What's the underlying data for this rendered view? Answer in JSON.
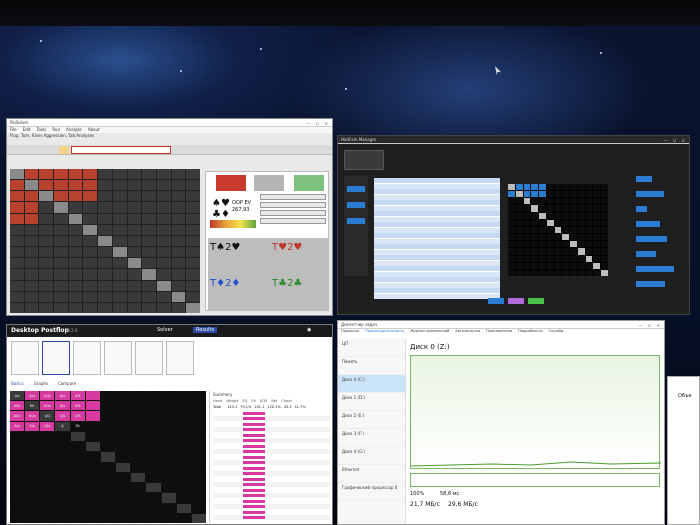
{
  "solver_window": {
    "title": "PioSolver",
    "menu": [
      "File",
      "Edit",
      "Tools",
      "Run",
      "Analyze",
      "About"
    ],
    "toolbar_line": "Flop, Turn, River Aggression, Tab Analyses",
    "ev_label": "OOP EV",
    "ev_value": "267.93",
    "card_boxes": [
      "T♠2♥",
      "T♥2♥",
      "T♦2♦",
      "T♣2♣"
    ],
    "legend_colors": [
      "#c83a2c",
      "#6a6a6a",
      "#3a8a3a"
    ]
  },
  "hud_window": {
    "title": "Hold'em Manager",
    "menu": [
      "Settings",
      "Help"
    ],
    "stat_labels": [
      "unknown",
      "unknown",
      "unknown",
      "unknown",
      "unknown"
    ],
    "bar_values": [
      0.32,
      0.55,
      0.22,
      0.48,
      0.62,
      0.4,
      0.75,
      0.58
    ]
  },
  "postflop": {
    "title": "Desktop Postflop",
    "version": "v0.2.6",
    "nav": [
      "Solver",
      "Results"
    ],
    "tabs": [
      "Basics",
      "Graphs",
      "Compare"
    ],
    "summary_label": "Summary",
    "column_headers": [
      "Hand",
      "Weight",
      "EQ",
      "EV",
      "EQR",
      "Bet",
      "Check"
    ],
    "hand_labels": [
      "AA",
      "AKs",
      "AQs",
      "AJs",
      "ATs",
      "AKo",
      "KK",
      "KQs",
      "KJs",
      "KTs",
      "AQo",
      "KQo",
      "QQ",
      "QJs",
      "QTs",
      "AJo",
      "KJo",
      "QJo",
      "JJ",
      "JTs"
    ],
    "summary_first_row": [
      "Total",
      "",
      "153.1",
      "79.1%",
      "201.1",
      "120.1%",
      "43.3",
      "41.7%"
    ]
  },
  "task_manager": {
    "title": "Диспетчер задач",
    "tabs": [
      "Процессы",
      "Производительность",
      "Журнал приложений",
      "Автозагрузка",
      "Пользователи",
      "Подробности",
      "Службы"
    ],
    "sidebar_items": [
      "ЦП",
      "Память",
      "Диск 0 (C:)",
      "Диск 1 (D:)",
      "Диск 2 (E:)",
      "Диск 3 (F:)",
      "Диск 4 (G:)",
      "Ethernet",
      "Графический процессор 0"
    ],
    "panel_title": "Диск 0 (Z:)",
    "active_time_label": "100%",
    "response_value": "58,6 мс",
    "read_speed": "21,7 МБ/с",
    "write_speed": "29,6 МБ/с"
  },
  "right_window": {
    "button_label": "Объе"
  }
}
